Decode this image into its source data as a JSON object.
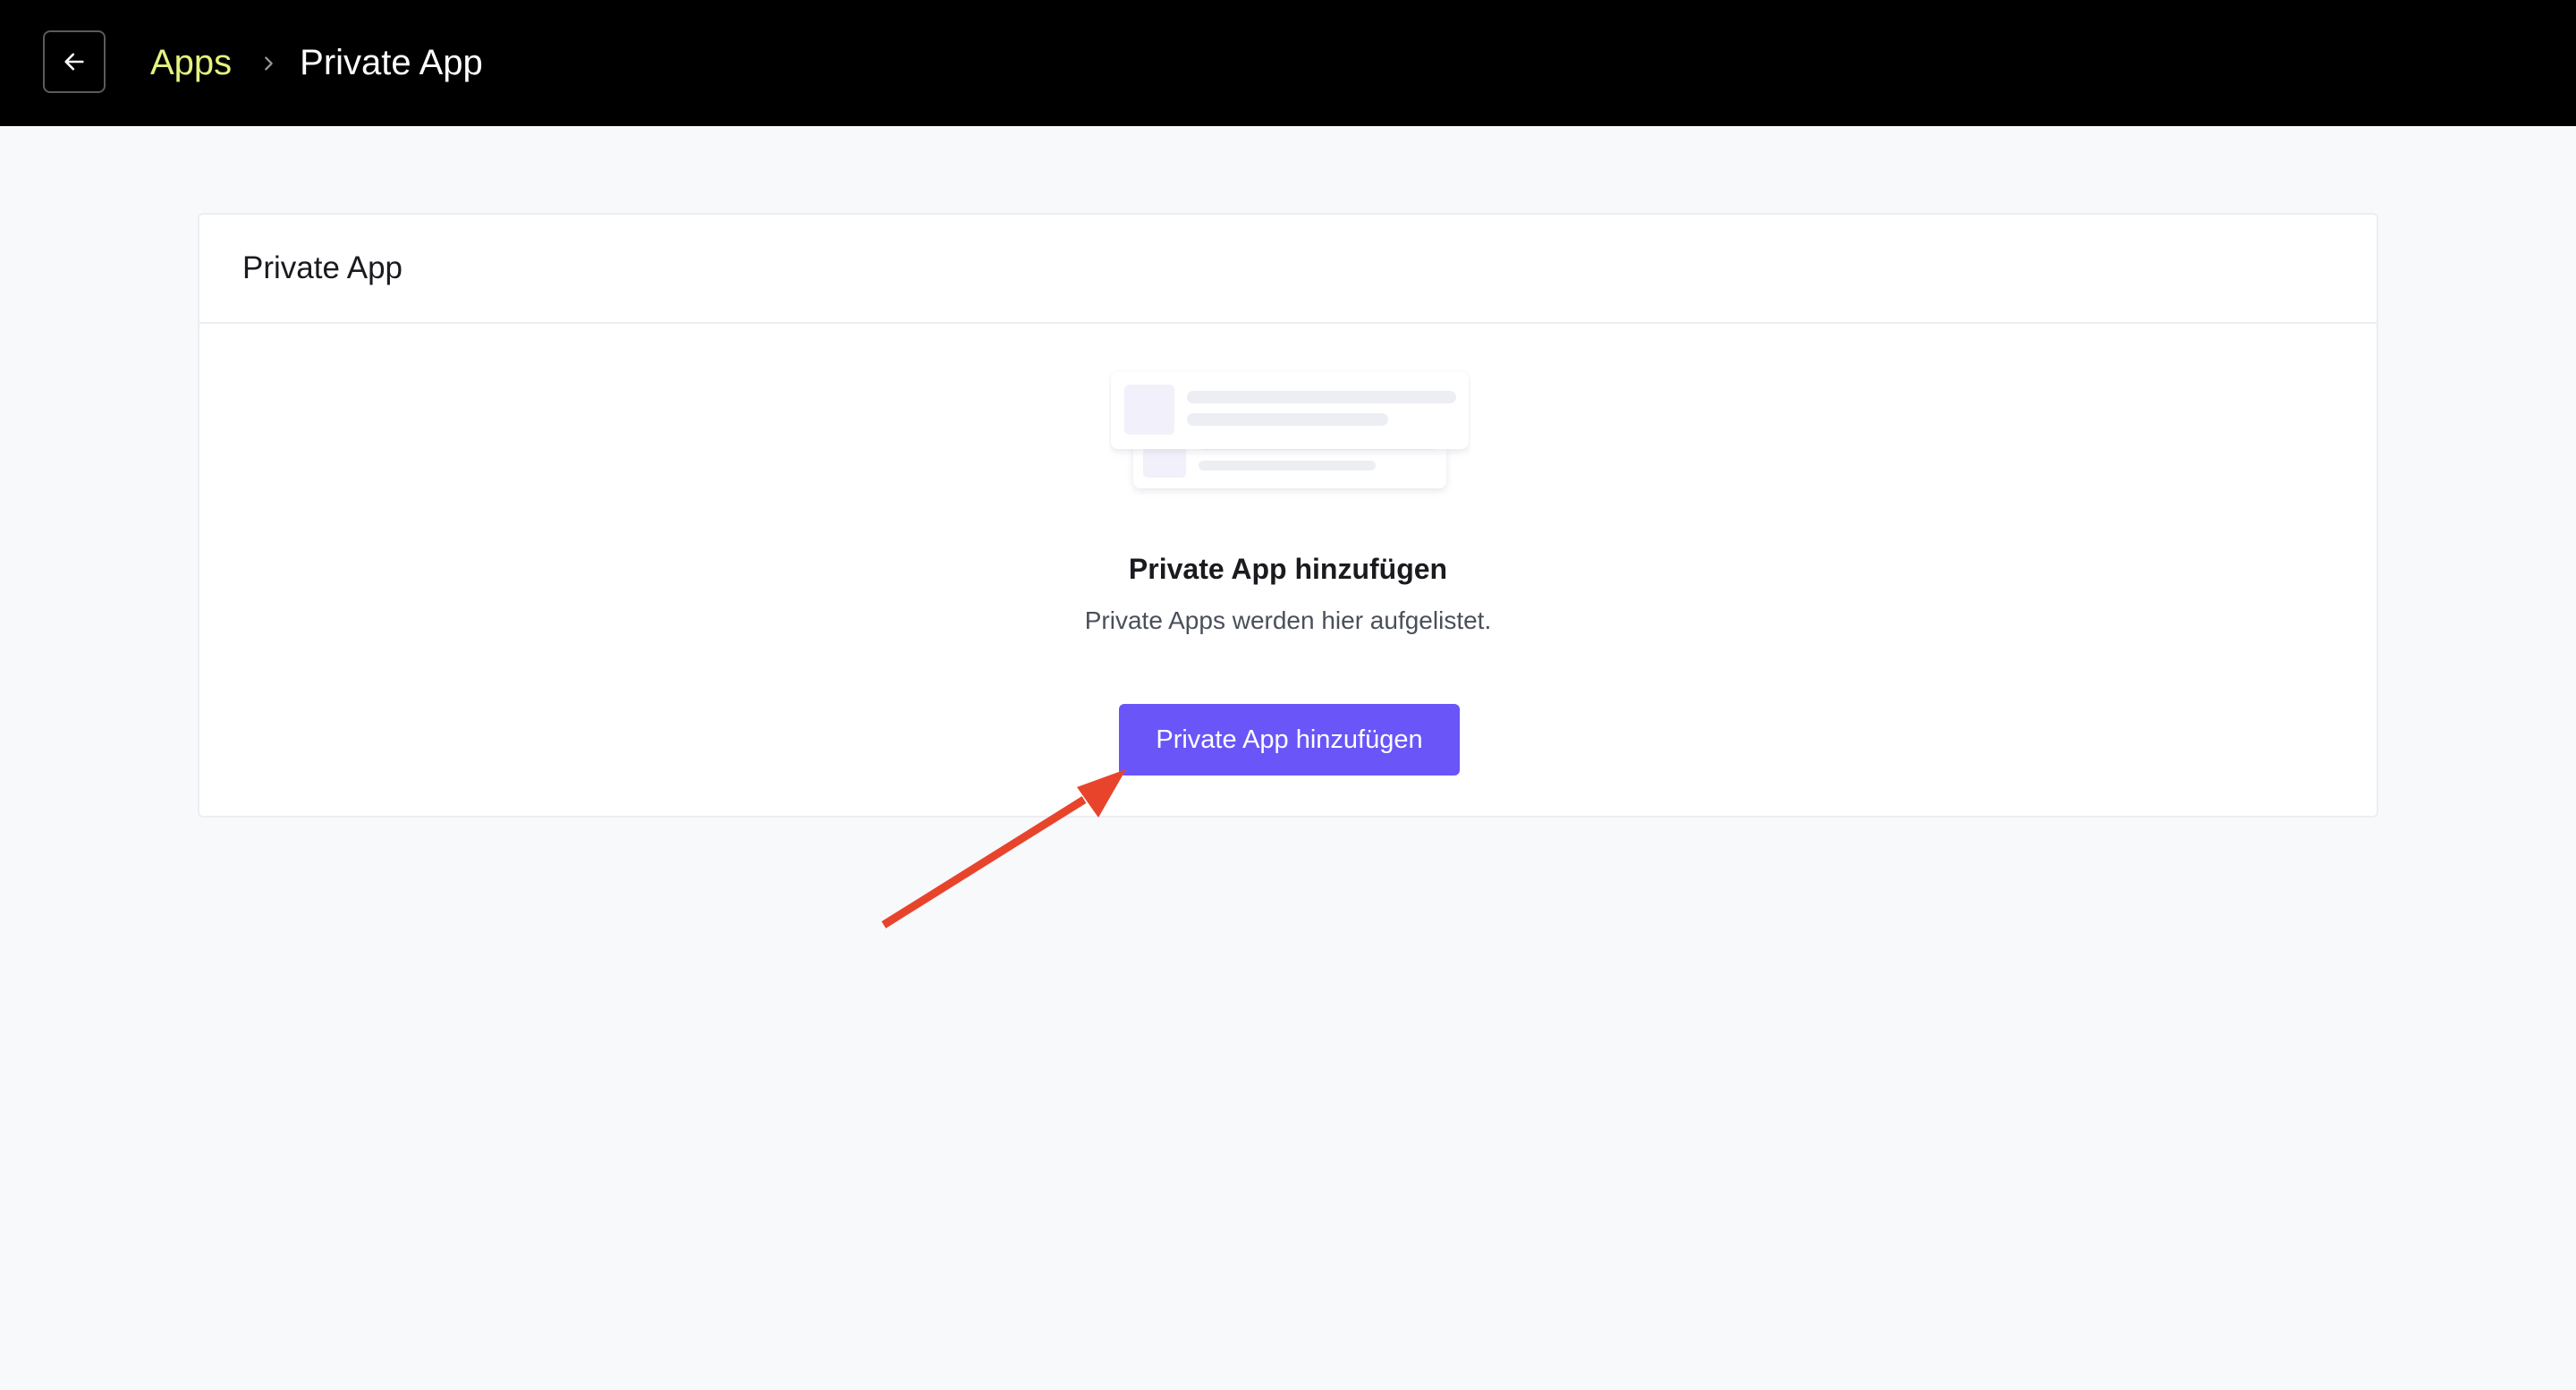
{
  "header": {
    "back_icon": "arrow-left-icon",
    "breadcrumb": {
      "parent_label": "Apps",
      "separator_icon": "chevron-right-icon",
      "current_label": "Private App"
    }
  },
  "card": {
    "title": "Private App",
    "empty_state": {
      "illustration": "list-placeholder-illustration",
      "title": "Private App hinzufügen",
      "description": "Private Apps werden hier aufgelistet.",
      "button_label": "Private App hinzufügen"
    }
  },
  "colors": {
    "topbar_bg": "#000000",
    "breadcrumb_link": "#e5f27e",
    "primary_button": "#6a55f8",
    "annotation_arrow": "#e8442c",
    "page_bg": "#f8f9fb"
  },
  "annotation": {
    "type": "arrow",
    "points_to": "add-private-app-button"
  }
}
